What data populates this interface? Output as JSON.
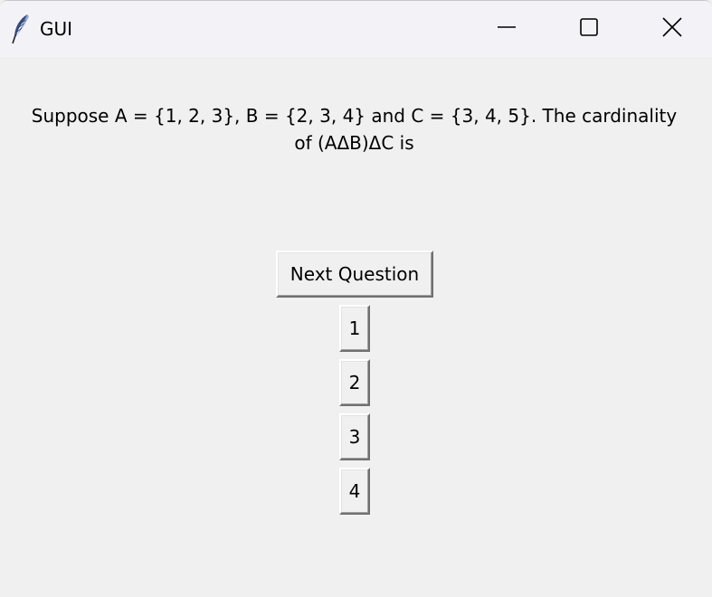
{
  "window": {
    "title": "GUI",
    "icon": "feather-icon",
    "controls": [
      "minimize-icon",
      "maximize-icon",
      "close-icon"
    ]
  },
  "main": {
    "question_line1": "Suppose A = {1, 2, 3}, B = {2, 3, 4} and C = {3, 4, 5}. The cardinality",
    "question_line2": "of (AΔB)ΔC is",
    "next_button_label": "Next Question",
    "options": [
      "1",
      "2",
      "3",
      "4"
    ]
  }
}
